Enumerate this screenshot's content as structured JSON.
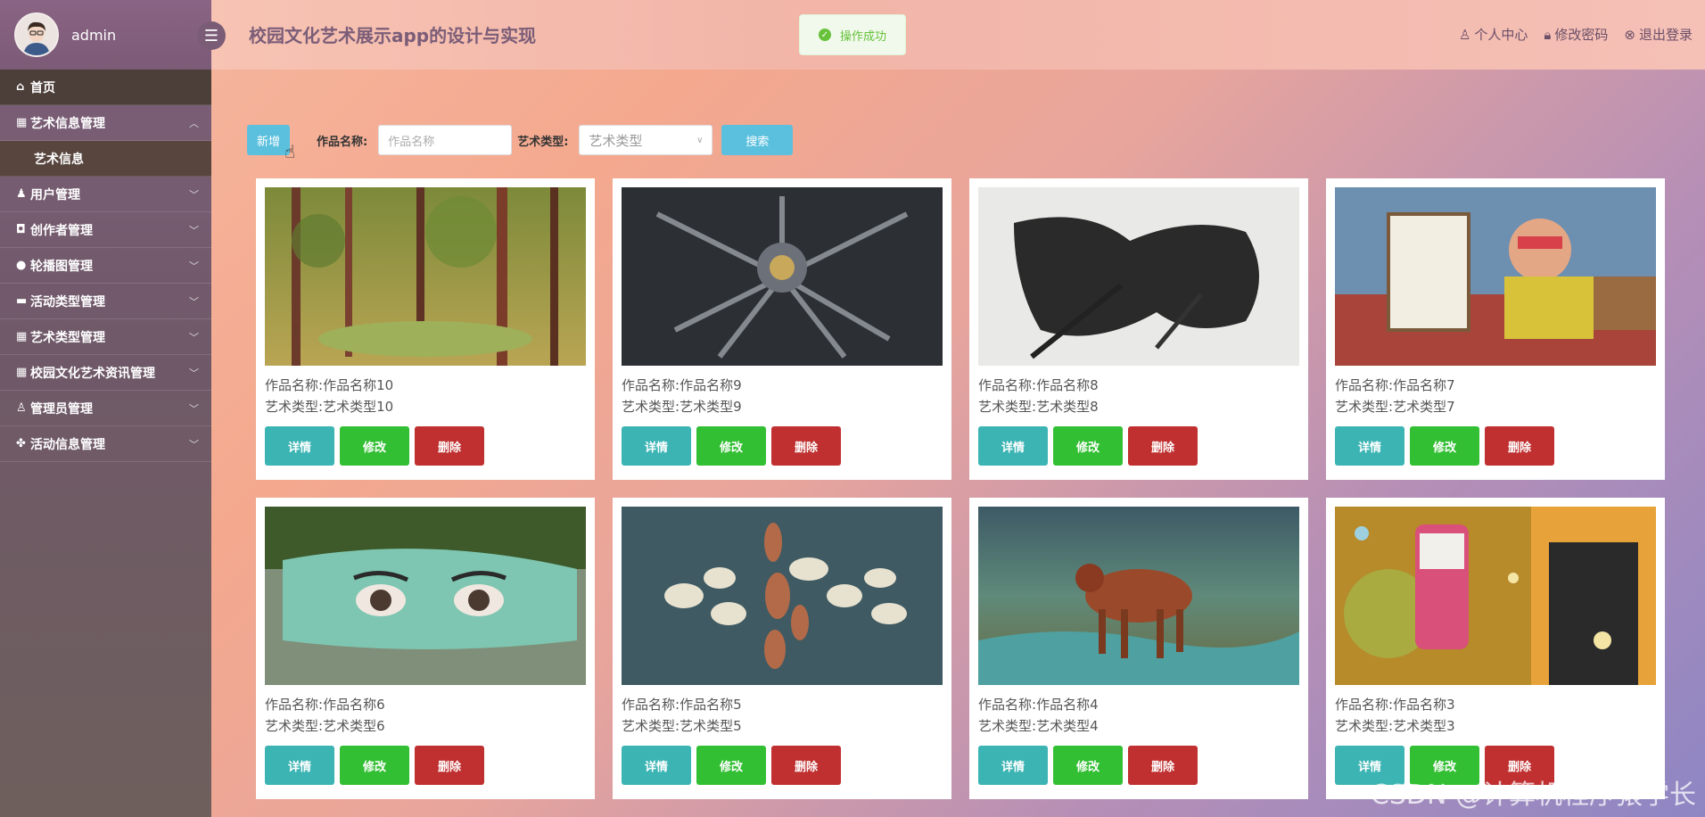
{
  "user": {
    "name": "admin"
  },
  "app_title": "校园文化艺术展示app的设计与实现",
  "toast": "操作成功",
  "top_links": [
    {
      "icon": "user-icon",
      "label": "个人中心"
    },
    {
      "icon": "lock-icon",
      "label": "修改密码"
    },
    {
      "icon": "logout-icon",
      "label": "退出登录"
    }
  ],
  "menu": [
    {
      "label": "首页",
      "icon": "home-icon",
      "chevron": ""
    },
    {
      "label": "艺术信息管理",
      "icon": "grid-icon",
      "chevron": "^"
    },
    {
      "label": "艺术信息",
      "sub": true
    },
    {
      "label": "用户管理",
      "icon": "users-icon",
      "chevron": "v"
    },
    {
      "label": "创作者管理",
      "icon": "box-icon",
      "chevron": "v"
    },
    {
      "label": "轮播图管理",
      "icon": "circle-icon",
      "chevron": "v"
    },
    {
      "label": "活动类型管理",
      "icon": "briefcase-icon",
      "chevron": "v"
    },
    {
      "label": "艺术类型管理",
      "icon": "grid-icon",
      "chevron": "v"
    },
    {
      "label": "校园文化艺术资讯管理",
      "icon": "grid-icon",
      "chevron": "v"
    },
    {
      "label": "管理员管理",
      "icon": "person-icon",
      "chevron": "v"
    },
    {
      "label": "活动信息管理",
      "icon": "puzzle-icon",
      "chevron": "v"
    }
  ],
  "search": {
    "add_label": "新增",
    "name_label": "作品名称:",
    "name_placeholder": "作品名称",
    "type_label": "艺术类型:",
    "type_placeholder": "艺术类型",
    "search_label": "搜索"
  },
  "cards": [
    {
      "name_label": "作品名称:",
      "name": "作品名称10",
      "type_label": "艺术类型:",
      "type": "艺术类型10"
    },
    {
      "name_label": "作品名称:",
      "name": "作品名称9",
      "type_label": "艺术类型:",
      "type": "艺术类型9"
    },
    {
      "name_label": "作品名称:",
      "name": "作品名称8",
      "type_label": "艺术类型:",
      "type": "艺术类型8"
    },
    {
      "name_label": "作品名称:",
      "name": "作品名称7",
      "type_label": "艺术类型:",
      "type": "艺术类型7"
    },
    {
      "name_label": "作品名称:",
      "name": "作品名称6",
      "type_label": "艺术类型:",
      "type": "艺术类型6"
    },
    {
      "name_label": "作品名称:",
      "name": "作品名称5",
      "type_label": "艺术类型:",
      "type": "艺术类型5"
    },
    {
      "name_label": "作品名称:",
      "name": "作品名称4",
      "type_label": "艺术类型:",
      "type": "艺术类型4"
    },
    {
      "name_label": "作品名称:",
      "name": "作品名称3",
      "type_label": "艺术类型:",
      "type": "艺术类型3"
    }
  ],
  "card_buttons": {
    "detail": "详情",
    "edit": "修改",
    "delete": "删除"
  },
  "watermark": "CSDN @计算机程序猿学长"
}
